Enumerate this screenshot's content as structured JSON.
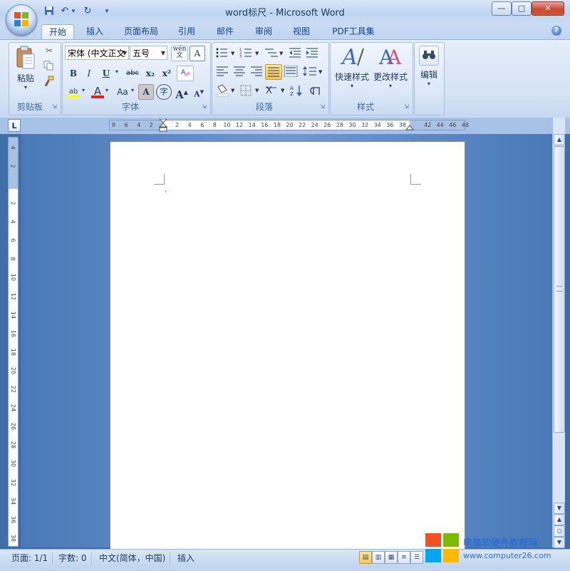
{
  "window": {
    "title": "word标尺 - Microsoft Word",
    "min": "—",
    "max": "□",
    "close": "✕"
  },
  "qat": {
    "save": "💾",
    "undo": "↶",
    "undo_dd": "▾",
    "redo": "↻",
    "customize": "▾"
  },
  "tabs": [
    "开始",
    "插入",
    "页面布局",
    "引用",
    "邮件",
    "审阅",
    "视图",
    "PDF工具集"
  ],
  "help": "?",
  "ribbon": {
    "clipboard": {
      "label": "剪贴板",
      "paste": "粘贴",
      "paste_dd": "▾"
    },
    "font": {
      "label": "字体",
      "name": "宋体 (中文正文",
      "size": "五号",
      "wen": "wén\n文",
      "border_a": "A",
      "bold": "B",
      "italic": "I",
      "underline": "U",
      "strike": "abc",
      "sub": "x₂",
      "sup": "x²",
      "clear": "A",
      "highlight": "ab",
      "fontcolor": "A",
      "case": "Aa",
      "shade": "A",
      "enclose": "字",
      "grow": "A",
      "shrink": "A"
    },
    "paragraph": {
      "label": "段落"
    },
    "styles": {
      "label": "样式",
      "quick": "快速样式",
      "change": "更改样式"
    },
    "editing": {
      "label": "编辑"
    }
  },
  "ruler": {
    "toggle": "L",
    "h_left": [
      "8",
      "6",
      "4",
      "2"
    ],
    "h_right": [
      "2",
      "4",
      "6",
      "8",
      "10",
      "12",
      "14",
      "16",
      "18",
      "20",
      "22",
      "24",
      "26",
      "28",
      "30",
      "32",
      "34",
      "36",
      "38",
      "",
      "42",
      "44",
      "46",
      "48"
    ],
    "v_top": [
      "4",
      "2"
    ],
    "v": [
      "2",
      "4",
      "6",
      "8",
      "10",
      "12",
      "14",
      "16",
      "18",
      "20",
      "22",
      "24",
      "26",
      "28",
      "30",
      "32",
      "34",
      "36",
      "38"
    ]
  },
  "status": {
    "page": "页面: 1/1",
    "words": "字数: 0",
    "lang": "中文(简体，中国)",
    "mode": "插入"
  },
  "watermark": {
    "text": "电脑软硬件教程网",
    "url": "www.computer26.com"
  },
  "colors": {
    "accent": "#15428b",
    "doc_bg": "#4a79b8",
    "page": "#ffffff"
  }
}
